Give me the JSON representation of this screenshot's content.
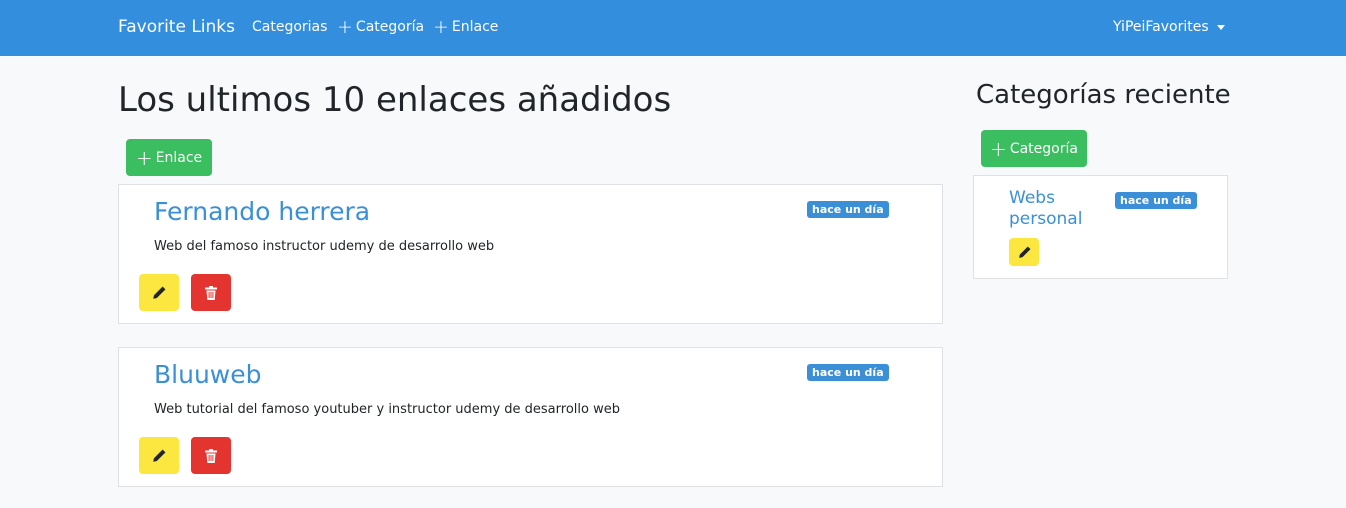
{
  "navbar": {
    "brand": "Favorite Links",
    "links": [
      {
        "label": "Categorias",
        "icon": ""
      },
      {
        "label": "Categoría",
        "icon": "plus-icon"
      },
      {
        "label": "Enlace",
        "icon": "plus-icon"
      }
    ],
    "user": "YiPeiFavorites"
  },
  "main": {
    "title": "Los ultimos 10 enlaces añadidos",
    "add_button_label": "Enlace",
    "links": [
      {
        "title": "Fernando herrera",
        "description": "Web del famoso instructor udemy de desarrollo web",
        "badge": "hace un día"
      },
      {
        "title": "Bluuweb",
        "description": "Web tutorial del famoso youtuber y instructor udemy de desarrollo web",
        "badge": "hace un día"
      }
    ]
  },
  "sidebar": {
    "title": "Categorías reciente",
    "add_button_label": "Categoría",
    "categories": [
      {
        "name_line1": "Webs",
        "name_line2": "personal",
        "badge": "hace un día"
      }
    ]
  },
  "colors": {
    "navbar": "#338fde",
    "green": "#3bbe5f",
    "yellow": "#fbe73f",
    "red": "#e33430",
    "link": "#3b8fd6"
  }
}
